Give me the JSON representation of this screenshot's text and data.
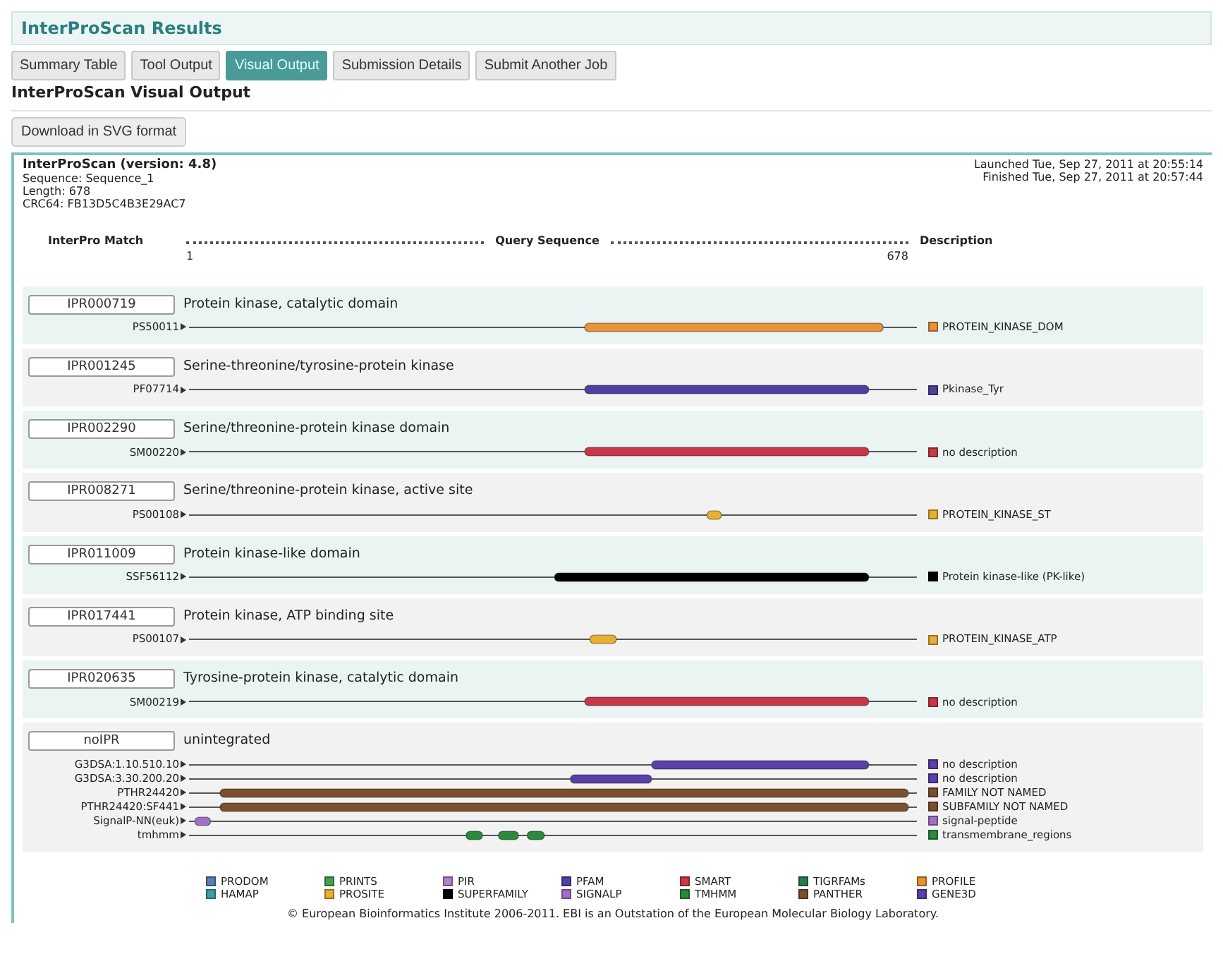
{
  "page_title": "InterProScan Results",
  "tabs": [
    {
      "label": "Summary Table",
      "selected": false
    },
    {
      "label": "Tool Output",
      "selected": false
    },
    {
      "label": "Visual Output",
      "selected": true
    },
    {
      "label": "Submission Details",
      "selected": false
    },
    {
      "label": "Submit Another Job",
      "selected": false
    }
  ],
  "heading": "InterProScan Visual Output",
  "download_button": "Download in SVG format",
  "result": {
    "title": "InterProScan (version: 4.8)",
    "sequence": "Sequence: Sequence_1",
    "length": "Length: 678",
    "crc": "CRC64: FB13D5C4B3E29AC7",
    "launched": "Launched Tue, Sep 27, 2011 at 20:55:14",
    "finished": "Finished Tue, Sep 27, 2011 at 20:57:44"
  },
  "header": {
    "match": "InterPro Match",
    "query": "Query Sequence",
    "start": "1",
    "end": "678",
    "description": "Description"
  },
  "matches": [
    {
      "id": "IPR000719",
      "name": "Protein kinase, catalytic domain",
      "features": [
        {
          "signature": "PS50011",
          "color": "#e8923a",
          "description": "PROTEIN_KINASE_DOM"
        }
      ]
    },
    {
      "id": "IPR001245",
      "name": "Serine-threonine/tyrosine-protein kinase",
      "features": [
        {
          "signature": "PF07714",
          "color": "#5040a0",
          "description": "Pkinase_Tyr"
        }
      ]
    },
    {
      "id": "IPR002290",
      "name": "Serine/threonine-protein kinase domain",
      "features": [
        {
          "signature": "SM00220",
          "color": "#c83848",
          "description": "no description"
        }
      ]
    },
    {
      "id": "IPR008271",
      "name": "Serine/threonine-protein kinase, active site",
      "features": [
        {
          "signature": "PS00108",
          "color": "#e8b030",
          "description": "PROTEIN_KINASE_ST"
        }
      ]
    },
    {
      "id": "IPR011009",
      "name": "Protein kinase-like domain",
      "features": [
        {
          "signature": "SSF56112",
          "color": "#000000",
          "description": "Protein kinase-like (PK-like)"
        }
      ]
    },
    {
      "id": "IPR017441",
      "name": "Protein kinase, ATP binding site",
      "features": [
        {
          "signature": "PS00107",
          "color": "#e8b030",
          "description": "PROTEIN_KINASE_ATP"
        }
      ]
    },
    {
      "id": "IPR020635",
      "name": "Tyrosine-protein kinase, catalytic domain",
      "features": [
        {
          "signature": "SM00219",
          "color": "#c83848",
          "description": "no description"
        }
      ]
    },
    {
      "id": "noIPR",
      "name": "unintegrated",
      "features": [
        {
          "signature": "G3DSA:1.10.510.10",
          "color": "#5a40a8",
          "description": "no description"
        },
        {
          "signature": "G3DSA:3.30.200.20",
          "color": "#5a40a8",
          "description": "no description"
        },
        {
          "signature": "PTHR24420",
          "color": "#7a5030",
          "description": "FAMILY NOT NAMED"
        },
        {
          "signature": "PTHR24420:SF441",
          "color": "#7a5030",
          "description": "SUBFAMILY NOT NAMED"
        },
        {
          "signature": "SignalP-NN(euk)",
          "color": "#a070c8",
          "description": "signal-peptide"
        },
        {
          "signature": "tmhmm",
          "color": "#2a8a40",
          "description": "transmembrane_regions"
        }
      ]
    }
  ],
  "legend": [
    {
      "label": "PRODOM",
      "color": "#5a7ab8"
    },
    {
      "label": "PRINTS",
      "color": "#40a050"
    },
    {
      "label": "PIR",
      "color": "#b080c8"
    },
    {
      "label": "PFAM",
      "color": "#5040a0"
    },
    {
      "label": "SMART",
      "color": "#c83848"
    },
    {
      "label": "TIGRFAMs",
      "color": "#2a7a50"
    },
    {
      "label": "PROFILE",
      "color": "#e89030"
    },
    {
      "label": "HAMAP",
      "color": "#40a0a0"
    },
    {
      "label": "PROSITE",
      "color": "#e8b030"
    },
    {
      "label": "SUPERFAMILY",
      "color": "#000000"
    },
    {
      "label": "SIGNALP",
      "color": "#a070c8"
    },
    {
      "label": "TMHMM",
      "color": "#2a8a40"
    },
    {
      "label": "PANTHER",
      "color": "#7a5030"
    },
    {
      "label": "GENE3D",
      "color": "#5a40a8"
    }
  ],
  "footer": "© European Bioinformatics Institute 2006-2011. EBI is an Outstation of the European Molecular Biology Laboratory."
}
